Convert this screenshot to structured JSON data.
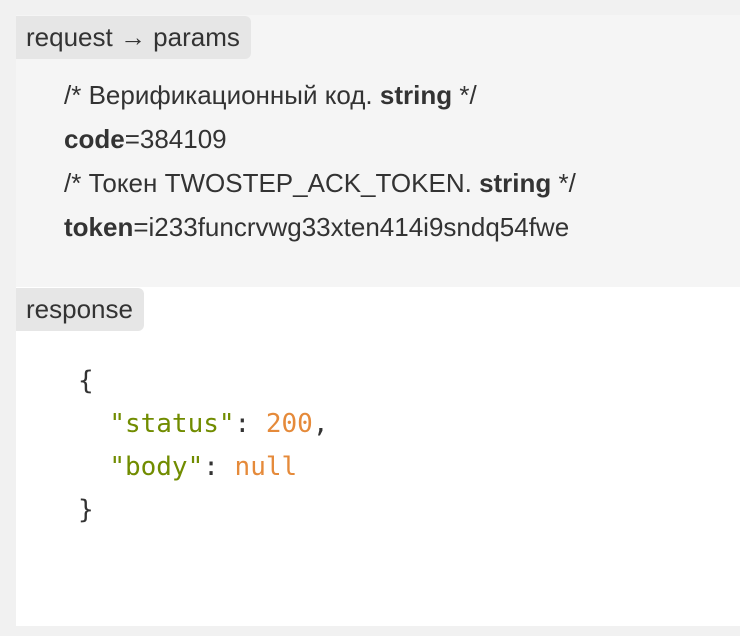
{
  "request_tag": "request → params",
  "params": [
    {
      "comment_prefix": "/* Верификационный код. ",
      "comment_type": "string",
      "comment_suffix": " */",
      "name": "code",
      "eq": "=",
      "value": "384109"
    },
    {
      "comment_prefix": "/* Токен TWOSTEP_ACK_TOKEN. ",
      "comment_type": "string",
      "comment_suffix": " */",
      "name": "token",
      "eq": "=",
      "value": "i233funcrvwg33xten414i9sndq54fwe"
    }
  ],
  "response_tag": "response",
  "response": {
    "open": "{",
    "close": "}",
    "status_key": "\"status\"",
    "status_value": "200",
    "body_key": "\"body\"",
    "body_value": "null"
  },
  "colors": {
    "string": "#718c00",
    "number": "#e58a3a",
    "text": "#333333",
    "panel": "#f5f5f5",
    "tag_bg": "#e6e6e6"
  }
}
